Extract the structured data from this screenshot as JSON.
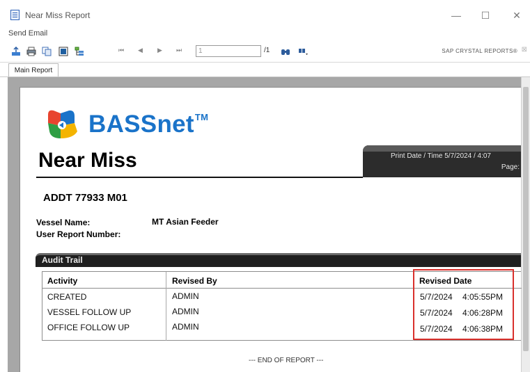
{
  "window": {
    "title": "Near Miss Report",
    "minimize_glyph": "—",
    "maximize_glyph": "☐",
    "close_glyph": "✕"
  },
  "menu": {
    "send_email": "Send Email"
  },
  "toolbar": {
    "page_value": "1",
    "page_total": "/1",
    "brand": "SAP CRYSTAL REPORTS®",
    "close_glyph": "⊠",
    "icons": [
      "export-icon",
      "print-icon",
      "copy-icon",
      "group-tree-icon",
      "parameter-icon",
      "first-page-icon",
      "previous-page-icon",
      "next-page-icon",
      "last-page-icon",
      "search-icon",
      "zoom-icon"
    ],
    "nav": {
      "first": "⏮",
      "previous": "◀",
      "next": "▶",
      "last": "⏭"
    }
  },
  "tabs": [
    {
      "label": "Main Report"
    }
  ],
  "report": {
    "logo_text": "BASSnet",
    "logo_tm": "TM",
    "title": "Near Miss",
    "print_label": "Print Date / Time  5/7/2024 /  4:07",
    "page_label": "Page:",
    "vessel_code": "ADDT 77933 M01",
    "vessel_name_label": "Vessel Name:",
    "vessel_name_value": "MT Asian Feeder",
    "user_report_label": "User Report Number:",
    "audit_section_title": "Audit Trail",
    "end_text": "--- END OF REPORT ---",
    "audit_table": {
      "headers": [
        "Activity",
        "Revised By",
        "Revised Date"
      ],
      "rows": [
        {
          "activity": "CREATED",
          "revised_by": "ADMIN",
          "date": "5/7/2024",
          "time": "4:05:55PM"
        },
        {
          "activity": "VESSEL FOLLOW UP",
          "revised_by": "ADMIN",
          "date": "5/7/2024",
          "time": "4:06:28PM"
        },
        {
          "activity": "OFFICE FOLLOW UP",
          "revised_by": "ADMIN",
          "date": "5/7/2024",
          "time": "4:06:38PM"
        }
      ]
    }
  },
  "colors": {
    "brand_blue": "#1a73c9",
    "highlight_red": "#d9302c",
    "viewer_gray": "#a7a7a7"
  }
}
